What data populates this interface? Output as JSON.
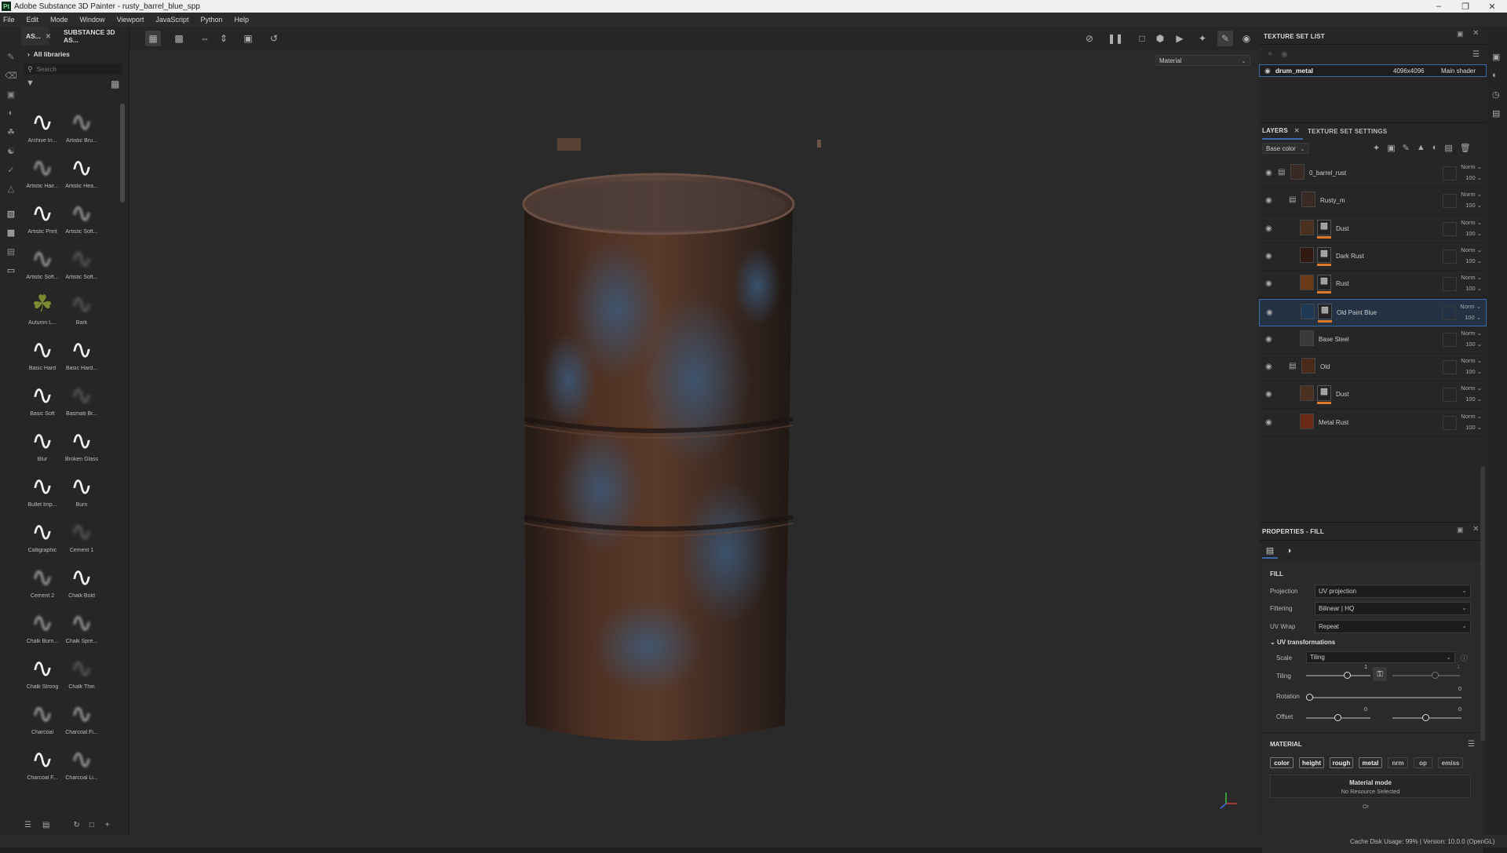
{
  "window": {
    "title": "Adobe Substance 3D Painter - rusty_barrel_blue_spp"
  },
  "menu": [
    "File",
    "Edit",
    "Mode",
    "Window",
    "Viewport",
    "JavaScript",
    "Python",
    "Help"
  ],
  "assets": {
    "tab1": "AS...",
    "tab2": "SUBSTANCE 3D AS...",
    "breadcrumb": "All libraries",
    "search_placeholder": "Search",
    "brushes": [
      {
        "name": "Archive In...",
        "style": "bold"
      },
      {
        "name": "Artistic Bru...",
        "style": "soft"
      },
      {
        "name": "Artistic Hair...",
        "style": "soft"
      },
      {
        "name": "Artistic Hea...",
        "style": "bold"
      },
      {
        "name": "Artistic Print",
        "style": "bold"
      },
      {
        "name": "Artistic Soft...",
        "style": "soft"
      },
      {
        "name": "Artistic Soft...",
        "style": "soft"
      },
      {
        "name": "Artistic Soft...",
        "style": "faint"
      },
      {
        "name": "Autumn L...",
        "style": "leaf"
      },
      {
        "name": "Bark",
        "style": "faint"
      },
      {
        "name": "Basic Hard",
        "style": "bold"
      },
      {
        "name": "Basic Hard...",
        "style": "bold"
      },
      {
        "name": "Basic Soft",
        "style": "bold"
      },
      {
        "name": "Basmati Br...",
        "style": "faint"
      },
      {
        "name": "Blur",
        "style": "bold"
      },
      {
        "name": "Broken Glass",
        "style": "bold"
      },
      {
        "name": "Bullet Imp...",
        "style": "bold"
      },
      {
        "name": "Burn",
        "style": "bold"
      },
      {
        "name": "Calligraphic",
        "style": "bold"
      },
      {
        "name": "Cement 1",
        "style": "faint"
      },
      {
        "name": "Cement 2",
        "style": "soft"
      },
      {
        "name": "Chalk Bold",
        "style": "bold"
      },
      {
        "name": "Chalk Burn...",
        "style": "soft"
      },
      {
        "name": "Chalk Spre...",
        "style": "soft"
      },
      {
        "name": "Chalk Strong",
        "style": "bold"
      },
      {
        "name": "Chalk Thin",
        "style": "faint"
      },
      {
        "name": "Charcoal",
        "style": "soft"
      },
      {
        "name": "Charcoal Fi...",
        "style": "soft"
      },
      {
        "name": "Charcoal F...",
        "style": "bold"
      },
      {
        "name": "Charcoal Li...",
        "style": "soft"
      },
      {
        "name": "",
        "style": "bold"
      },
      {
        "name": "",
        "style": "bold"
      }
    ]
  },
  "viewport": {
    "mode_select": "Material"
  },
  "texture_set_list": {
    "title": "TEXTURE SET LIST",
    "row": {
      "name": "drum_metal",
      "resolution": "4096x4096",
      "shader": "Main shader"
    }
  },
  "layers_panel": {
    "tab_layers": "LAYERS",
    "tab_tss": "TEXTURE SET SETTINGS",
    "channel_select": "Base color",
    "layers": [
      {
        "name": "0_barrel_rust",
        "type": "folder",
        "indent": 0,
        "blend": "Norm",
        "opacity": "100",
        "color": "#3a2a25",
        "mask": false,
        "orange": false,
        "selected": false
      },
      {
        "name": "Rusty_m",
        "type": "folder",
        "indent": 1,
        "blend": "Norm",
        "opacity": "100",
        "color": "#3a2a25",
        "mask": false,
        "orange": false,
        "selected": false
      },
      {
        "name": "Dust",
        "type": "fill",
        "indent": 2,
        "blend": "Norm",
        "opacity": "100",
        "color": "#4a3020",
        "mask": true,
        "orange": true,
        "selected": false
      },
      {
        "name": "Dark Rust",
        "type": "fill",
        "indent": 2,
        "blend": "Norm",
        "opacity": "100",
        "color": "#301a12",
        "mask": true,
        "orange": true,
        "selected": false
      },
      {
        "name": "Rust",
        "type": "fill",
        "indent": 2,
        "blend": "Norm",
        "opacity": "100",
        "color": "#6a3a18",
        "mask": true,
        "orange": true,
        "selected": false
      },
      {
        "name": "Old Paint Blue",
        "type": "fill",
        "indent": 2,
        "blend": "Norm",
        "opacity": "100",
        "color": "#1e3a55",
        "mask": true,
        "orange": true,
        "selected": true
      },
      {
        "name": "Base Steel",
        "type": "fill",
        "indent": 2,
        "blend": "Norm",
        "opacity": "100",
        "color": "#3a3a3a",
        "mask": false,
        "orange": false,
        "selected": false
      },
      {
        "name": "Old",
        "type": "folder",
        "indent": 1,
        "blend": "Norm",
        "opacity": "100",
        "color": "#4a2a1a",
        "mask": false,
        "orange": false,
        "selected": false
      },
      {
        "name": "Dust",
        "type": "fill",
        "indent": 2,
        "blend": "Norm",
        "opacity": "100",
        "color": "#4a3020",
        "mask": true,
        "orange": true,
        "selected": false
      },
      {
        "name": "Metal Rust",
        "type": "fill",
        "indent": 2,
        "blend": "Norm",
        "opacity": "100",
        "color": "#6a2a18",
        "mask": false,
        "orange": false,
        "selected": false
      }
    ]
  },
  "properties": {
    "title": "PROPERTIES - FILL",
    "section_fill": "FILL",
    "projection_label": "Projection",
    "projection_value": "UV projection",
    "filtering_label": "Filtering",
    "filtering_value": "Bilinear | HQ",
    "uvwrap_label": "UV Wrap",
    "uvwrap_value": "Repeat",
    "uvt_title": "UV transformations",
    "scale_label": "Scale",
    "scale_value": "Tiling",
    "tiling_label": "Tiling",
    "tiling_value": "1",
    "tiling_value2": "1",
    "rotation_label": "Rotation",
    "rotation_value": "0",
    "offset_label": "Offset",
    "offset_value_x": "0",
    "offset_value_y": "0",
    "section_material": "MATERIAL",
    "channels": [
      {
        "label": "color",
        "on": true
      },
      {
        "label": "height",
        "on": true
      },
      {
        "label": "rough",
        "on": true
      },
      {
        "label": "metal",
        "on": true
      },
      {
        "label": "nrm",
        "on": false
      },
      {
        "label": "op",
        "on": false
      },
      {
        "label": "emiss",
        "on": false
      }
    ],
    "material_mode_title": "Material mode",
    "material_mode_sub": "No Resource Selected",
    "or_text": "Or"
  },
  "status": {
    "text": "Cache Disk Usage:   99%  |  Version: 10.0.0 (OpenGL)"
  },
  "colors": {
    "accent": "#3b6aa8",
    "orange": "#e07a2a",
    "panel": "#262626"
  }
}
